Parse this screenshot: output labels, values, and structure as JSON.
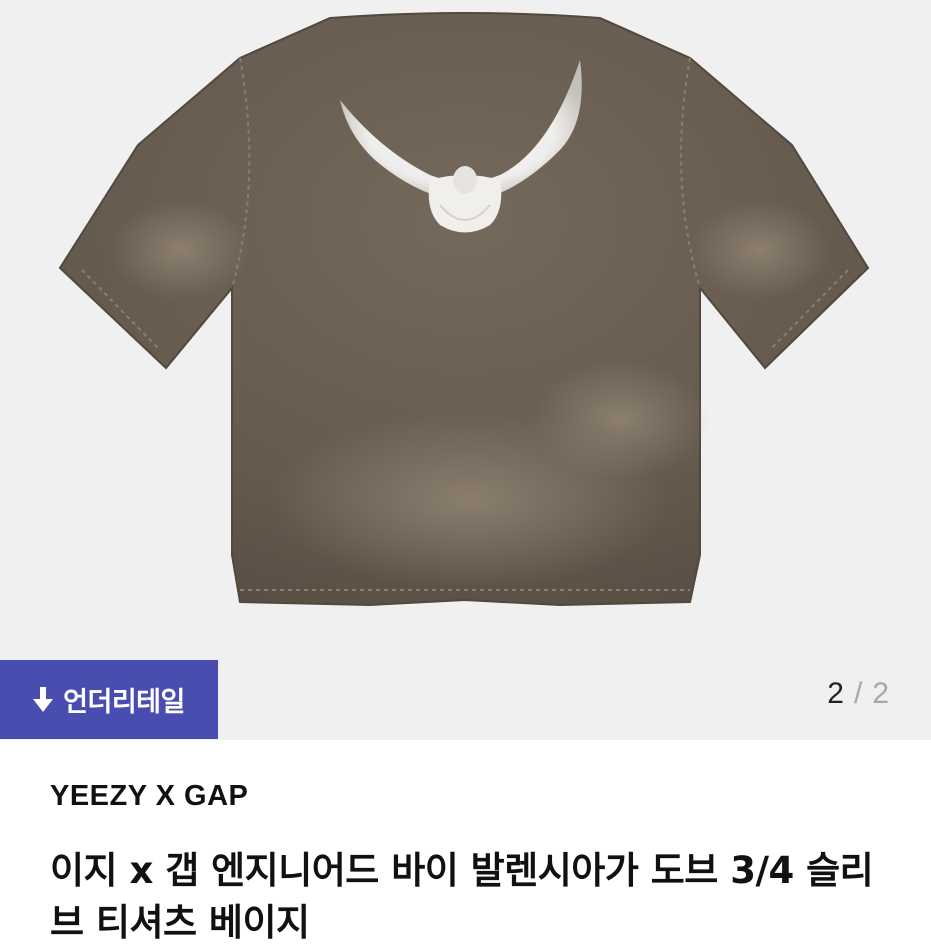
{
  "gallery": {
    "image_alt": "dove graphic t-shirt",
    "badge_label": "언더리테일",
    "badge_icon": "arrow-down-icon",
    "counter_current": "2",
    "counter_separator": "/",
    "counter_total": "2"
  },
  "product": {
    "brand": "YEEZY X GAP",
    "title": "이지 x 갭 엔지니어드 바이 발렌시아가 도브 3/4 슬리브 티셔츠 베이지"
  },
  "colors": {
    "badge_background": "#4a4db0",
    "gallery_background": "#f0f0f0",
    "shirt": "#6e6154"
  }
}
